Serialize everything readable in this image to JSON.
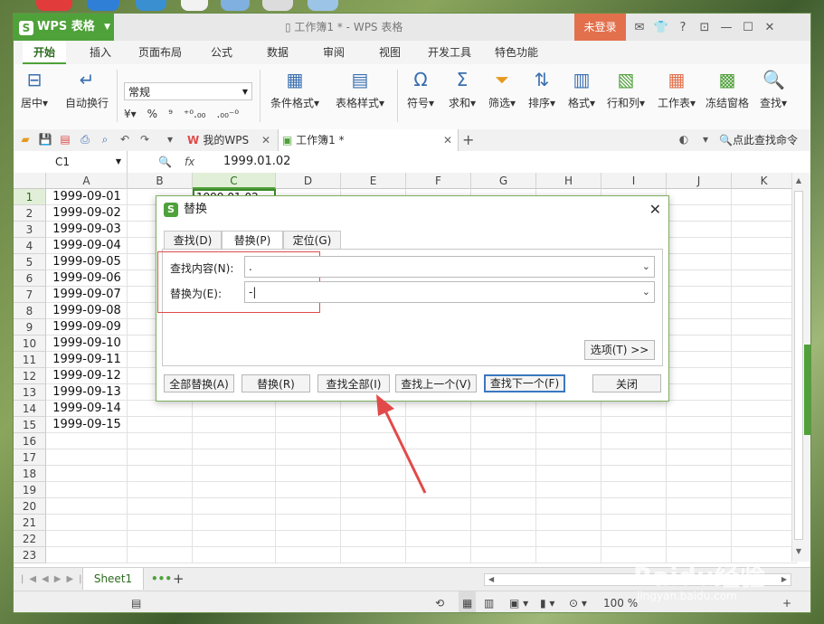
{
  "colors": {
    "accent": "#4fa13a",
    "login": "#e2704c",
    "annotation": "#e24a4a",
    "focus": "#3a78c0"
  },
  "titlebar": {
    "app_name": "WPS 表格",
    "app_logo": "S",
    "window_title": "工作簿1 * - WPS 表格",
    "login": "未登录",
    "icons": [
      "mail-icon",
      "shirt-icon",
      "help-icon",
      "restore-icon",
      "minimize-icon",
      "maximize-icon",
      "close-icon"
    ]
  },
  "ribbon_tabs": [
    "开始",
    "插入",
    "页面布局",
    "公式",
    "数据",
    "审阅",
    "视图",
    "开发工具",
    "特色功能"
  ],
  "ribbon": {
    "left": [
      {
        "label": "居中▾",
        "icon": "merge-icon"
      },
      {
        "label": "自动换行",
        "icon": "wrap-icon"
      }
    ],
    "number_format": "常规",
    "num_buttons": [
      "¥▾",
      "%",
      "⁹",
      "⁺⁰.₀₀",
      ".₀₀⁻⁰"
    ],
    "mid": [
      {
        "label": "条件格式▾",
        "icon": "conditional-format-icon"
      },
      {
        "label": "表格样式▾",
        "icon": "table-style-icon"
      }
    ],
    "right": [
      {
        "label": "符号▾",
        "icon": "symbol-icon"
      },
      {
        "label": "求和▾",
        "icon": "sum-icon"
      },
      {
        "label": "筛选▾",
        "icon": "filter-icon"
      },
      {
        "label": "排序▾",
        "icon": "sort-icon"
      },
      {
        "label": "格式▾",
        "icon": "format-icon"
      },
      {
        "label": "行和列▾",
        "icon": "row-col-icon"
      },
      {
        "label": "工作表▾",
        "icon": "worksheet-icon"
      },
      {
        "label": "冻结窗格",
        "icon": "freeze-icon"
      },
      {
        "label": "查找▾",
        "icon": "find-icon"
      }
    ]
  },
  "doc_tabs": [
    {
      "label": "我的WPS",
      "active": false
    },
    {
      "label": "工作簿1 *",
      "active": true
    }
  ],
  "quick_search": "点此查找命令",
  "formula": {
    "name_box": "C1",
    "fx": "fx",
    "value": "1999.01.02"
  },
  "columns": [
    "A",
    "B",
    "C",
    "D",
    "E",
    "F",
    "G",
    "H",
    "I",
    "J",
    "K"
  ],
  "rows": [
    "1",
    "2",
    "3",
    "4",
    "5",
    "6",
    "7",
    "8",
    "9",
    "10",
    "11",
    "12",
    "13",
    "14",
    "15",
    "16",
    "17",
    "18",
    "19",
    "20",
    "21",
    "22",
    "23"
  ],
  "cells_a": [
    "1999-09-01",
    "1999-09-02",
    "1999-09-03",
    "1999-09-04",
    "1999-09-05",
    "1999-09-06",
    "1999-09-07",
    "1999-09-08",
    "1999-09-09",
    "1999-09-10",
    "1999-09-11",
    "1999-09-12",
    "1999-09-13",
    "1999-09-14",
    "1999-09-15"
  ],
  "cell_c1": "1999.01.02",
  "sheet": {
    "name": "Sheet1",
    "more": "•••",
    "add": "+"
  },
  "status": {
    "zoom": "100 %"
  },
  "dialog": {
    "title": "替换",
    "tabs": [
      "查找(D)",
      "替换(P)",
      "定位(G)"
    ],
    "find_label": "查找内容(N):",
    "find_value": ".",
    "replace_label": "替换为(E):",
    "replace_value": "-|",
    "options_label": "选项(T) >>",
    "buttons": [
      "全部替换(A)",
      "替换(R)",
      "查找全部(I)",
      "查找上一个(V)",
      "查找下一个(F)",
      "关闭"
    ]
  },
  "watermark": {
    "text": "Baidu经验",
    "sub": "jingyan.baidu.com"
  }
}
